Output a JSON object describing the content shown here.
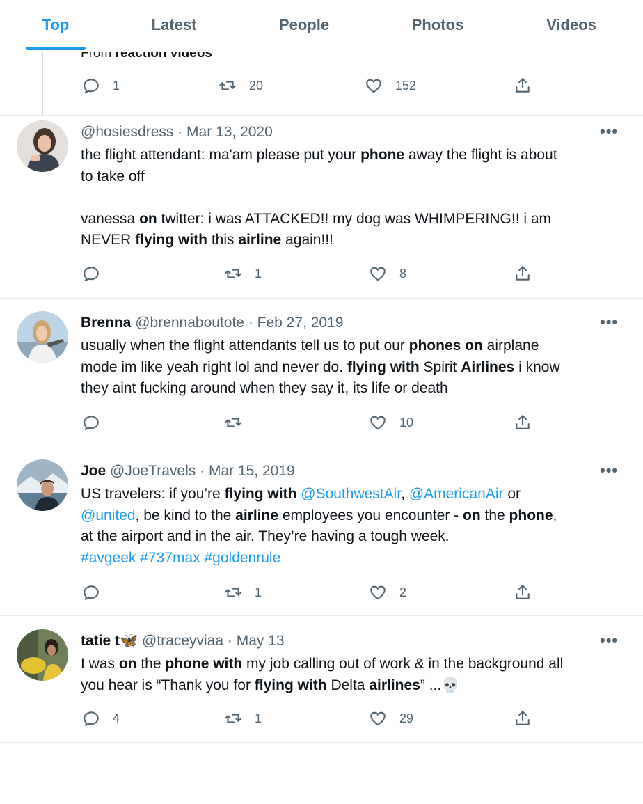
{
  "tabs": [
    {
      "label": "Top",
      "active": true
    },
    {
      "label": "Latest"
    },
    {
      "label": "People"
    },
    {
      "label": "Photos"
    },
    {
      "label": "Videos"
    }
  ],
  "partial_tweet": {
    "cut_text_prefix": "From ",
    "cut_text_bold": "reaction videos",
    "replies": "1",
    "retweets": "20",
    "likes": "152"
  },
  "tweets": [
    {
      "name": "",
      "handle": "@hosiesdress",
      "date": "· Mar 13, 2020",
      "replies": "",
      "retweets": "1",
      "likes": "8",
      "text": {
        "l1a": "the flight attendant: ma'am please put your ",
        "l1b": "phone",
        "l1c": " away the flight is about",
        "l2": "to take off",
        "l3a": "vanessa ",
        "l3b": "on",
        "l3c": " twitter: i was ATTACKED!! my dog was WHIMPERING!! i am",
        "l4a": "NEVER ",
        "l4b": "flying with",
        "l4c": " this ",
        "l4d": "airline",
        "l4e": " again!!!"
      }
    },
    {
      "name": "Brenna",
      "handle": "@brennaboutote",
      "date": "· Feb 27, 2019",
      "replies": "",
      "retweets": "",
      "likes": "10",
      "text": {
        "l1a": "usually when the flight attendants tell us to put our ",
        "l1b": "phones on",
        "l1c": " airplane",
        "l2a": "mode im like yeah right lol and never do. ",
        "l2b": "flying with",
        "l2c": " Spirit ",
        "l2d": "Airlines",
        "l2e": " i know",
        "l3": "they aint fucking around when they say it, its life or death"
      }
    },
    {
      "name": "Joe",
      "handle": "@JoeTravels",
      "date": "· Mar 15, 2019",
      "replies": "",
      "retweets": "1",
      "likes": "2",
      "text": {
        "l1a": "US travelers: if you’re ",
        "l1b": "flying with",
        "l1c": " ",
        "l1d": "@SouthwestAir",
        "l1e": ", ",
        "l1f": "@AmericanAir",
        "l1g": " or",
        "l2a": "@united",
        "l2b": ", be kind to the ",
        "l2c": "airline",
        "l2d": " employees you encounter - ",
        "l2e": "on",
        "l2f": " the ",
        "l2g": "phone",
        "l2h": ",",
        "l3": "at the airport and in the air. They’re having a tough week.",
        "l4a": "#avgeek",
        "l4b": "#737max",
        "l4c": "#goldenrule"
      }
    },
    {
      "name": "tatie t🦋",
      "handle": "@traceyviaa",
      "date": "· May 13",
      "replies": "4",
      "retweets": "1",
      "likes": "29",
      "text": {
        "l1a": "I was ",
        "l1b": "on",
        "l1c": " the ",
        "l1d": "phone with",
        "l1e": " my job calling out of work & in the background all",
        "l2a": "you hear is “Thank you for ",
        "l2b": "flying with",
        "l2c": " Delta ",
        "l2d": "airlines",
        "l2e": "” ...💀"
      }
    }
  ],
  "more_label": "•••",
  "colors": {
    "accent": "#1d9bf0",
    "text": "#0f1419",
    "muted": "#536471",
    "border": "#e6ecf0"
  }
}
